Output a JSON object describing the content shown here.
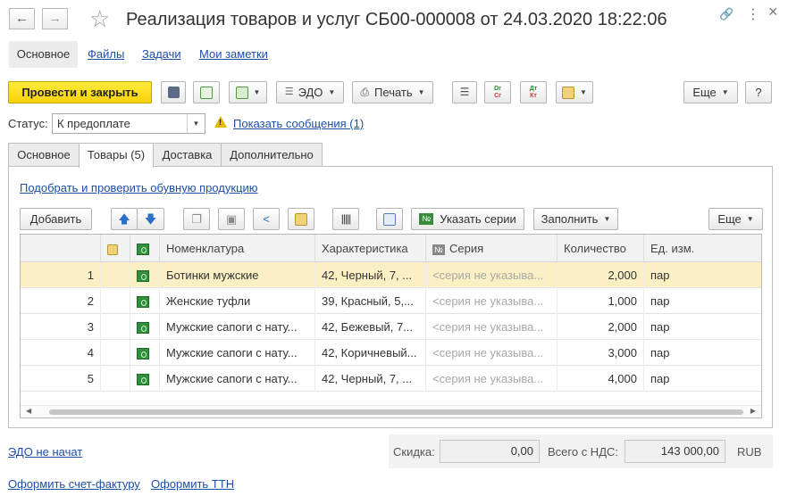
{
  "window": {
    "title": "Реализация товаров и услуг СБ00-000008 от 24.03.2020 18:22:06",
    "back_glyph": "←",
    "forward_glyph": "→",
    "link_glyph": "🔗",
    "more_glyph": "⋮",
    "close_glyph": "×"
  },
  "section_tabs": [
    "Основное",
    "Файлы",
    "Задачи",
    "Мои заметки"
  ],
  "commandbar": {
    "post_close": "Провести и закрыть",
    "edo": "ЭДО",
    "print": "Печать",
    "more": "Еще",
    "help": "?",
    "dr_top": "Dr",
    "dr_bottom": "Cr",
    "dt_top": "Дт",
    "dt_bottom": "Кт"
  },
  "status": {
    "label": "Статус:",
    "value": "К предоплате",
    "messages_link": "Показать сообщения (1)"
  },
  "form_tabs": [
    "Основное",
    "Товары (5)",
    "Доставка",
    "Дополнительно"
  ],
  "shoe_link": "Подобрать и проверить обувную продукцию",
  "table_toolbar": {
    "add": "Добавить",
    "series": "Указать серии",
    "series_icon_text": "№",
    "fill": "Заполнить",
    "more": "Еще"
  },
  "table": {
    "columns": [
      "Номенклатура",
      "Характеристика",
      "Серия",
      "Количество",
      "Ед. изм."
    ],
    "series_header_icon": "№",
    "rows": [
      {
        "n": "1",
        "item": "Ботинки мужские",
        "char": "42, Черный, 7, ...",
        "series": "<серия не указыва...",
        "qty": "2,000",
        "unit": "пар"
      },
      {
        "n": "2",
        "item": "Женские туфли",
        "char": "39, Красный, 5,...",
        "series": "<серия не указыва...",
        "qty": "1,000",
        "unit": "пар"
      },
      {
        "n": "3",
        "item": "Мужские сапоги с нату...",
        "char": "42, Бежевый, 7...",
        "series": "<серия не указыва...",
        "qty": "2,000",
        "unit": "пар"
      },
      {
        "n": "4",
        "item": "Мужские сапоги с нату...",
        "char": "42, Коричневый...",
        "series": "<серия не указыва...",
        "qty": "3,000",
        "unit": "пар"
      },
      {
        "n": "5",
        "item": "Мужские сапоги с нату...",
        "char": "42, Черный, 7, ...",
        "series": "<серия не указыва...",
        "qty": "4,000",
        "unit": "пар"
      }
    ]
  },
  "footer": {
    "edo_link": "ЭДО не начат",
    "discount_label": "Скидка:",
    "discount_value": "0,00",
    "total_label": "Всего с НДС:",
    "total_value": "143 000,00",
    "currency": "RUB",
    "invoice_link": "Оформить счет-фактуру",
    "ttn_link": "Оформить ТТН"
  },
  "colors": {
    "primary_button": "#f7d40a",
    "link": "#1e4fa8",
    "selected_row": "#fbefc4"
  }
}
